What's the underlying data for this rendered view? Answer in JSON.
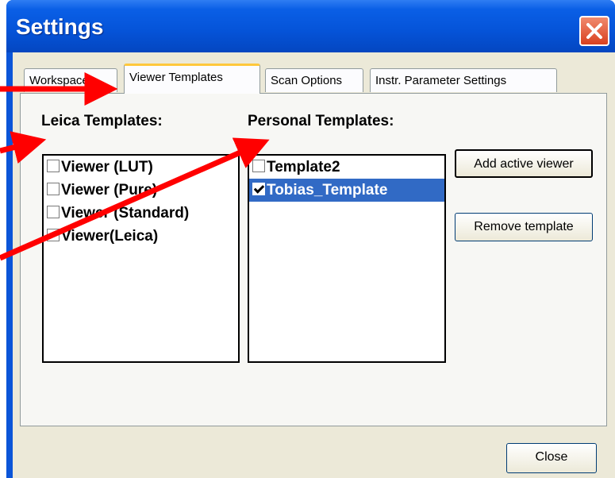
{
  "window": {
    "title": "Settings",
    "close_icon": "close-icon"
  },
  "tabs": [
    {
      "label": "Workspace",
      "active": false
    },
    {
      "label": "Viewer Templates",
      "active": true
    },
    {
      "label": "Scan Options",
      "active": false
    },
    {
      "label": "Instr. Parameter Settings",
      "active": false
    }
  ],
  "leica_templates": {
    "label": "Leica Templates:",
    "items": [
      {
        "label": "Viewer (LUT)",
        "checked": false
      },
      {
        "label": "Viewer (Pure)",
        "checked": false
      },
      {
        "label": "Viewer (Standard)",
        "checked": false
      },
      {
        "label": "Viewer(Leica)",
        "checked": false
      }
    ]
  },
  "personal_templates": {
    "label": "Personal Templates:",
    "items": [
      {
        "label": "Template2",
        "checked": false,
        "selected": false
      },
      {
        "label": "Tobias_Template",
        "checked": true,
        "selected": true
      }
    ]
  },
  "buttons": {
    "add_active_viewer": "Add active viewer",
    "remove_template": "Remove template",
    "close": "Close"
  },
  "colors": {
    "title_bar": "#0553d8",
    "annotation_arrow": "#ff0000",
    "selection": "#316ac5",
    "active_tab_highlight": "#ffc83c"
  }
}
